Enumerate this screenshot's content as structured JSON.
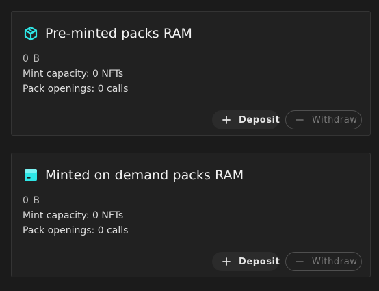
{
  "colors": {
    "background": "#1b1b1b",
    "card": "#212121",
    "accent": "#2ee6e6"
  },
  "cards": [
    {
      "title": "Pre-minted packs RAM",
      "icon": "cube-icon",
      "size": "0 B",
      "mint_capacity": "Mint capacity: 0 NFTs",
      "pack_openings": "Pack openings: 0 calls",
      "deposit_label": "Deposit",
      "withdraw_label": "Withdraw"
    },
    {
      "title": "Minted on demand packs RAM",
      "icon": "box-icon",
      "size": "0 B",
      "mint_capacity": "Mint capacity: 0 NFTs",
      "pack_openings": "Pack openings: 0 calls",
      "deposit_label": "Deposit",
      "withdraw_label": "Withdraw"
    }
  ]
}
